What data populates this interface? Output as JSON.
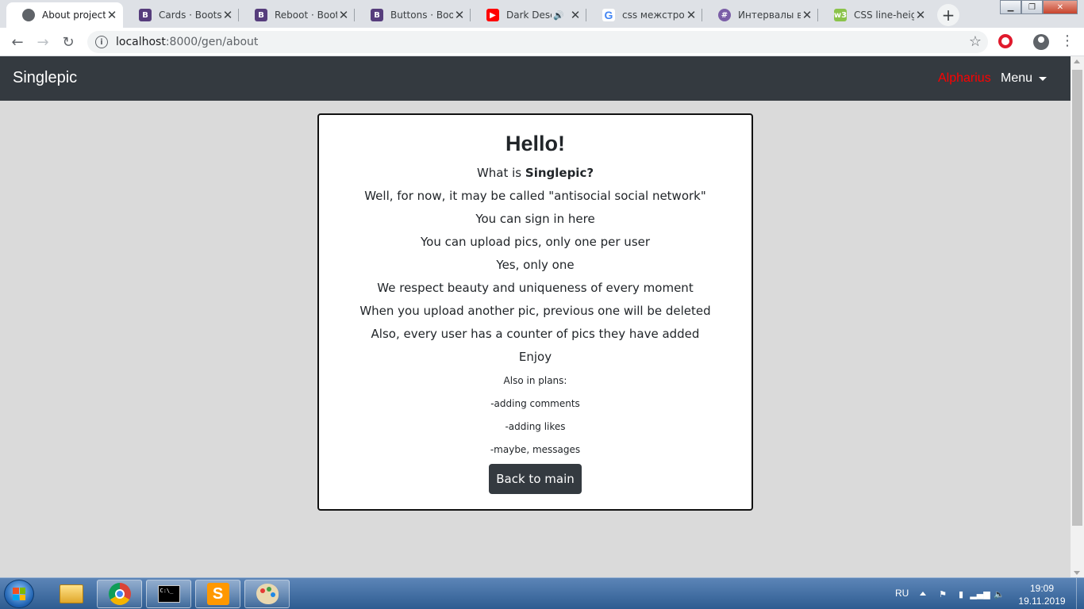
{
  "browser": {
    "tabs": [
      {
        "title": "About project",
        "favicon": "globe-icon",
        "active": true
      },
      {
        "title": "Cards · Bootstrap",
        "favicon": "bootstrap-icon"
      },
      {
        "title": "Reboot · Bootstrap",
        "favicon": "bootstrap-icon"
      },
      {
        "title": "Buttons · Bootstrap",
        "favicon": "bootstrap-icon"
      },
      {
        "title": "Dark Desert",
        "favicon": "youtube-icon",
        "audio": true
      },
      {
        "title": "css межстрочный",
        "favicon": "google-icon"
      },
      {
        "title": "Интервалы в CSS",
        "favicon": "hash-icon"
      },
      {
        "title": "CSS line-height",
        "favicon": "w3schools-icon"
      }
    ],
    "url_host": "localhost",
    "url_path": ":8000/gen/about"
  },
  "navbar": {
    "brand": "Singlepic",
    "user": "Alpharius",
    "menu": "Menu"
  },
  "card": {
    "heading": "Hello!",
    "intro_prefix": "What is ",
    "intro_bold": "Singlepic?",
    "lines": [
      "Well, for now, it may be called \"antisocial social network\"",
      "You can sign in here",
      "You can upload pics, only one per user",
      "Yes, only one",
      "We respect beauty and uniqueness of every moment",
      "When you upload another pic, previous one will be deleted",
      "Also, every user has a counter of pics they have added",
      "Enjoy"
    ],
    "plans": [
      "Also in plans:",
      "-adding comments",
      "-adding likes",
      "-maybe, messages"
    ],
    "button": "Back to main"
  },
  "taskbar": {
    "language": "RU",
    "time": "19:09",
    "date": "19.11.2019"
  },
  "colors": {
    "navbar_bg": "#343a40",
    "user_link": "#ff0000",
    "page_bg": "#dadada"
  }
}
